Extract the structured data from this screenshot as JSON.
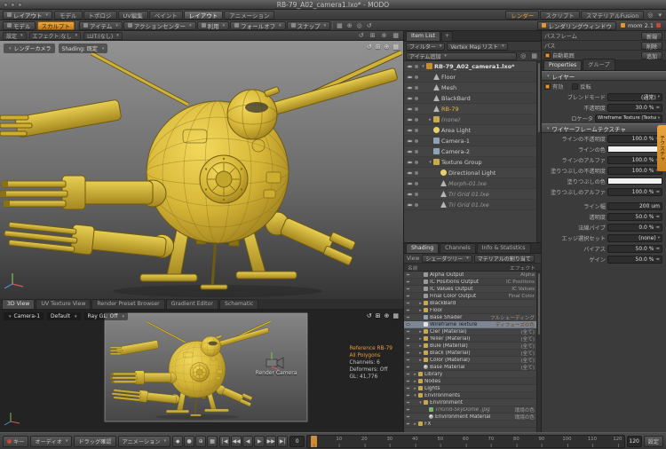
{
  "colors": {
    "accent": "#e8952f",
    "selection": "#7c8793",
    "robot_yellow": "#d6b637"
  },
  "window": {
    "title": "RB-79_A02_camera1.lxo* - MODO"
  },
  "menubar": {
    "layout_switcher": "レイアウト",
    "tabs": [
      {
        "label": "モデル"
      },
      {
        "label": "トポロジ"
      },
      {
        "label": "UV編集"
      },
      {
        "label": "ペイント"
      },
      {
        "label": "レイアウト",
        "active": true
      },
      {
        "label": "アニメーション"
      }
    ],
    "right_tabs": [
      {
        "label": "レンダー",
        "accent": true
      },
      {
        "label": "スクリプト"
      },
      {
        "label": "スマテリアルFusion"
      }
    ]
  },
  "toolbar": {
    "model_button": "モデル",
    "sculpt_button": "スカルプト",
    "dropdowns": [
      {
        "label": "アイテム"
      },
      {
        "label": "アクションセンター"
      },
      {
        "label": "利用"
      },
      {
        "label": "フォールオフ"
      },
      {
        "label": "スナップ"
      }
    ],
    "icons": [
      {
        "name": "grid-icon",
        "glyph": "▦"
      },
      {
        "name": "axis-icon",
        "glyph": "⊕"
      },
      {
        "name": "snap-icon",
        "glyph": "◎"
      },
      {
        "name": "reset-icon",
        "glyph": "↺"
      }
    ],
    "render_window_button": "レンダリングウィンドウ",
    "version": "mom 2.1"
  },
  "viewport": {
    "header_items": [
      "設定",
      "エフェクト:なし",
      "LUT:(なし)"
    ],
    "camera_dropdown": "レンダーカメラ",
    "shading_dropdown": "Shading: 既定"
  },
  "viewport_icons": [
    {
      "name": "orbit-icon",
      "glyph": "↺"
    },
    {
      "name": "pan-icon",
      "glyph": "⊞"
    },
    {
      "name": "zoom-icon",
      "glyph": "⊕"
    },
    {
      "name": "options-icon",
      "glyph": "▦"
    }
  ],
  "viewport_cam": {
    "tabs": [
      {
        "label": "3D View",
        "active": true
      },
      {
        "label": "UV Texture View"
      },
      {
        "label": "Render Preset Browser"
      },
      {
        "label": "Gradient Editor"
      },
      {
        "label": "Schematic"
      }
    ],
    "camera_dropdown": "Camera-1",
    "preset_dropdown": "Default",
    "raygl_dropdown": "Ray GL: Off",
    "caption": "Render Camera",
    "stats": [
      {
        "text": "Reference RB-79",
        "accent": true
      },
      {
        "text": "All Polygons",
        "accent": true
      },
      {
        "text": "Channels: 6"
      },
      {
        "text": "Deformers: Off"
      },
      {
        "text": "GL: 41,776"
      }
    ]
  },
  "item_list": {
    "tab": "Item List",
    "filter_label": "フィルター",
    "vmap_label": "Vertex Map リスト",
    "add_button": "アイテム追加",
    "rows": [
      {
        "name": "RB-79_A02_camera1.lxo*",
        "level": 0,
        "type": "scene",
        "bold": true,
        "expanded": true
      },
      {
        "name": "Floor",
        "level": 1,
        "type": "mesh"
      },
      {
        "name": "Mesh",
        "level": 1,
        "type": "mesh"
      },
      {
        "name": "BlackBard",
        "level": 1,
        "type": "mesh"
      },
      {
        "name": "RB-79",
        "level": 1,
        "type": "mesh",
        "selected": true
      },
      {
        "name": "(none)",
        "level": 1,
        "type": "group",
        "dim": true
      },
      {
        "name": "Area Light",
        "level": 1,
        "type": "light"
      },
      {
        "name": "Camera-1",
        "level": 1,
        "type": "camera"
      },
      {
        "name": "Camera-2",
        "level": 1,
        "type": "camera"
      },
      {
        "name": "Texture Group",
        "level": 1,
        "type": "group",
        "expanded": true
      },
      {
        "name": "Directional Light",
        "level": 2,
        "type": "light"
      },
      {
        "name": "Morph-01.lxe",
        "level": 2,
        "type": "mesh",
        "dim": true
      },
      {
        "name": "Tri Grid 01.lxe",
        "level": 2,
        "type": "mesh",
        "dim": true
      },
      {
        "name": "Tri Grid 01.lxe",
        "level": 2,
        "type": "mesh",
        "dim": true
      }
    ]
  },
  "shading": {
    "tabs": [
      {
        "label": "Shading",
        "active": true
      },
      {
        "label": "Channels"
      },
      {
        "label": "Info & Statistics"
      }
    ],
    "view_label": "View",
    "view_value": "シェーダツリー",
    "assign_button": "マテリアルの割り当て",
    "name_col": "名前",
    "effect_col": "エフェクト",
    "rows": [
      {
        "name": "Alpha Output",
        "effect": "Alpha",
        "level": 1,
        "type": "output"
      },
      {
        "name": "IC Positions Output",
        "effect": "IC Positions",
        "level": 1,
        "type": "output"
      },
      {
        "name": "IC Values Output",
        "effect": "IC Values",
        "level": 1,
        "type": "output"
      },
      {
        "name": "Final Color Output",
        "effect": "Final Color",
        "level": 1,
        "type": "output"
      },
      {
        "name": "BlackBard",
        "effect": "",
        "level": 1,
        "type": "folder"
      },
      {
        "name": "Floor",
        "effect": "",
        "level": 1,
        "type": "folder"
      },
      {
        "name": "Base Shader",
        "effect": "フルシェーディング",
        "level": 1,
        "type": "shader"
      },
      {
        "name": "Wireframe Texture",
        "effect": "ディフューズの色",
        "level": 1,
        "type": "texture",
        "selected": true
      },
      {
        "name": "Cler (Material)",
        "effect": "(全て)",
        "level": 1,
        "type": "folder"
      },
      {
        "name": "Yeller (Material)",
        "effect": "(全て)",
        "level": 1,
        "type": "folder"
      },
      {
        "name": "Bule (Material)",
        "effect": "(全て)",
        "level": 1,
        "type": "folder"
      },
      {
        "name": "Black (Material)",
        "effect": "(全て)",
        "level": 1,
        "type": "folder"
      },
      {
        "name": "Color (Material)",
        "effect": "(全て)",
        "level": 1,
        "type": "folder"
      },
      {
        "name": "Base Material",
        "effect": "(全て)",
        "level": 1,
        "type": "material"
      },
      {
        "name": "Library",
        "effect": "",
        "level": 0,
        "type": "folder"
      },
      {
        "name": "Nodes",
        "effect": "",
        "level": 0,
        "type": "folder"
      },
      {
        "name": "Lights",
        "effect": "",
        "level": 0,
        "type": "folder"
      },
      {
        "name": "Environments",
        "effect": "",
        "level": 0,
        "type": "folder",
        "expanded": true
      },
      {
        "name": "Environment",
        "effect": "",
        "level": 1,
        "type": "folder",
        "expanded": true
      },
      {
        "name": "TriGrid-SkyDome .jpg",
        "effect": "環境の色",
        "level": 2,
        "type": "image",
        "dim": true
      },
      {
        "name": "Environment Material",
        "effect": "環境の色",
        "level": 2,
        "type": "material"
      },
      {
        "name": "FX",
        "effect": "",
        "level": 0,
        "type": "folder"
      }
    ]
  },
  "properties": {
    "pass_rows": [
      {
        "label": "パスフレーム",
        "button": "新規"
      },
      {
        "label": "パス",
        "button": "削除"
      }
    ],
    "auto_range": "自動範囲",
    "add_button": "追加",
    "tabs": [
      {
        "label": "Properties",
        "active": true
      },
      {
        "label": "グループ"
      }
    ],
    "sections": {
      "layer": "レイヤー",
      "texture": "ワイヤーフレームテクスチャ"
    },
    "enabled_label": "有効",
    "invert_label": "反転",
    "blend_label": "ブレンドモード",
    "blend_value": "(通常)",
    "opacity_label": "不透明度",
    "opacity_value": "30.0 %",
    "locator_label": "ロケータ",
    "locator_value": "Wireframe Texture (Texture)",
    "side_tab": "テクスチャ",
    "texture_rows": [
      {
        "label": "ラインの不透明度",
        "value": "100.0 %",
        "kind": "slider"
      },
      {
        "label": "ラインの色",
        "kind": "color",
        "color": "#f2f2f2"
      },
      {
        "label": "ラインのアルファ",
        "value": "100.0 %",
        "kind": "slider"
      },
      {
        "label": "塗りつぶしの不透明度",
        "value": "100.0 %",
        "kind": "slider"
      },
      {
        "label": "塗りつぶしの色",
        "kind": "color",
        "color": "#f2f2f2"
      },
      {
        "label": "塗りつぶしのアルファ",
        "value": "100.0 %",
        "kind": "slider"
      },
      {
        "label": "ライン幅",
        "value": "200 um",
        "kind": "field"
      },
      {
        "label": "透明度",
        "value": "50.0 %",
        "kind": "slider"
      },
      {
        "label": "法線パイプ",
        "value": "0.0 %",
        "kind": "slider"
      },
      {
        "label": "エッジ選択セット",
        "value": "(none)",
        "kind": "dropdown"
      },
      {
        "label": "バイアス",
        "value": "50.0 %",
        "kind": "slider"
      },
      {
        "label": "ゲイン",
        "value": "50.0 %",
        "kind": "slider"
      }
    ]
  },
  "timeline": {
    "key_button": "キー",
    "audio_button": "オーディオ",
    "drag_button": "ドラッグ確認",
    "anim_dropdown": "アニメーション",
    "left_icons": [
      {
        "name": "keyframe-icon",
        "glyph": "◆"
      },
      {
        "name": "auto-key-icon",
        "glyph": "●"
      },
      {
        "name": "magnet-icon",
        "glyph": "⊕"
      },
      {
        "name": "filter-icon",
        "glyph": "▦"
      }
    ],
    "transport": [
      {
        "name": "go-start-button",
        "glyph": "|◀"
      },
      {
        "name": "prev-key-button",
        "glyph": "◀◀"
      },
      {
        "name": "step-back-button",
        "glyph": "◀"
      },
      {
        "name": "play-button",
        "glyph": "▶"
      },
      {
        "name": "step-forward-button",
        "glyph": "▶▶"
      },
      {
        "name": "go-end-button",
        "glyph": "▶|"
      }
    ],
    "current_frame": "0",
    "range_end": "120",
    "ticks": [
      "0",
      "10",
      "20",
      "30",
      "40",
      "50",
      "60",
      "70",
      "80",
      "90",
      "100",
      "110",
      "120"
    ],
    "settings_button": "設定"
  }
}
